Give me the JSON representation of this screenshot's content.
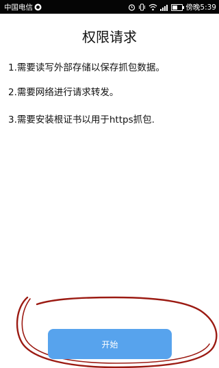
{
  "status_bar": {
    "carrier": "中国电信",
    "clock": "傍晚5:39",
    "battery_level": 0.45
  },
  "title": "权限请求",
  "permissions": [
    "1.需要读写外部存储以保存抓包数据。",
    "2.需要网络进行请求转发。",
    "3.需要安装根证书以用于https抓包."
  ],
  "start_button": "开始",
  "colors": {
    "button": "#57a3ed",
    "annotation_circle": "#9b1a12"
  }
}
